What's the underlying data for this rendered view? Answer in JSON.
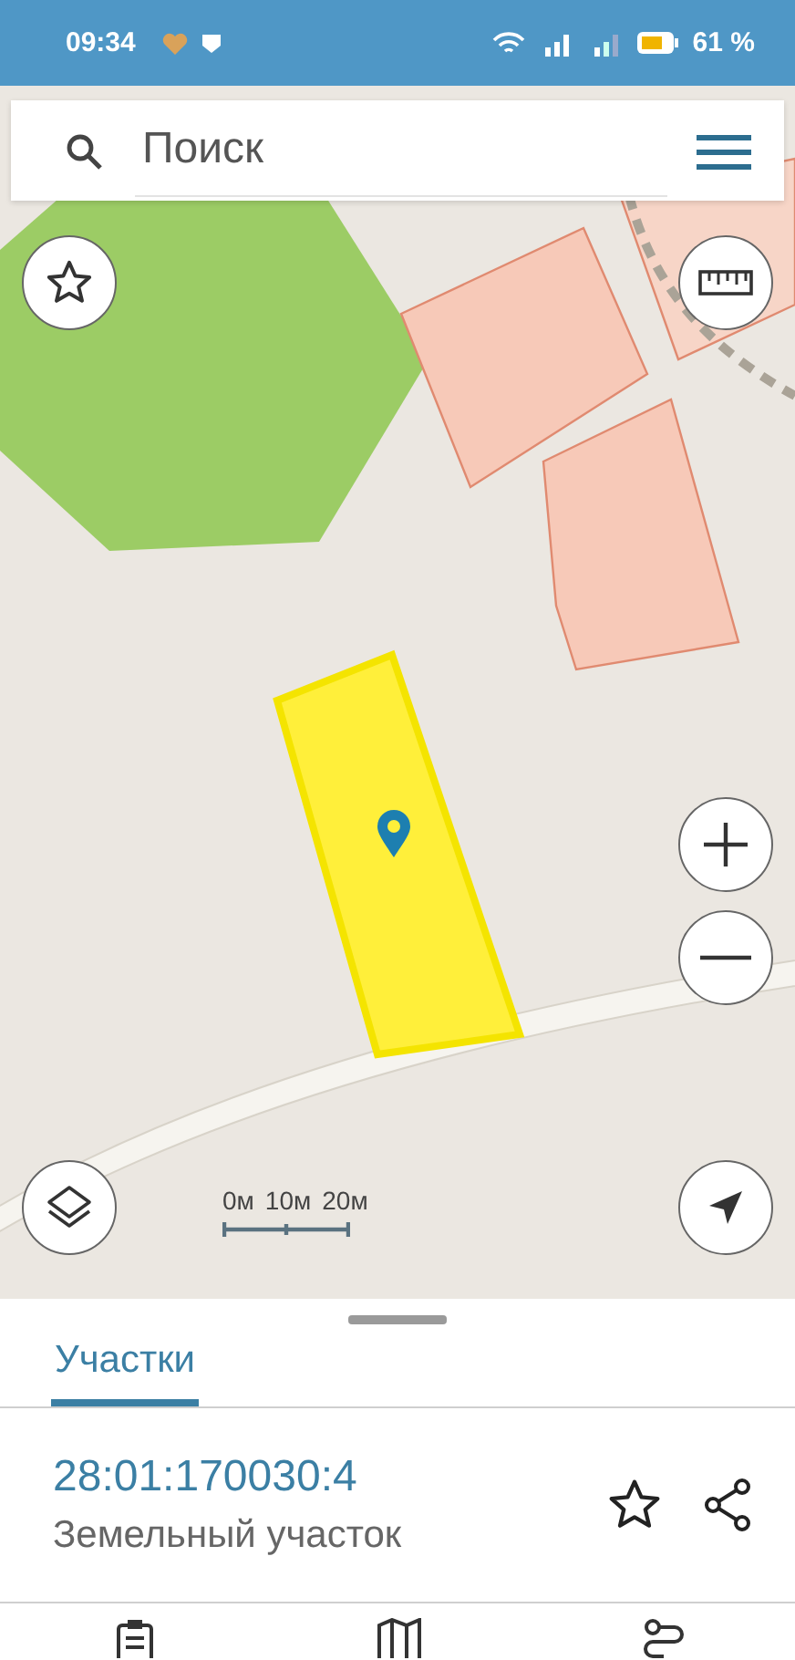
{
  "status_bar": {
    "time": "09:34",
    "battery": "61 %"
  },
  "search": {
    "placeholder": "Поиск"
  },
  "map": {
    "scale_labels": [
      "0м",
      "10м",
      "20м"
    ]
  },
  "tabs": [
    {
      "label": "Участки",
      "selected": true
    }
  ],
  "parcel": {
    "number": "28:01:170030:4",
    "type": "Земельный участок"
  }
}
